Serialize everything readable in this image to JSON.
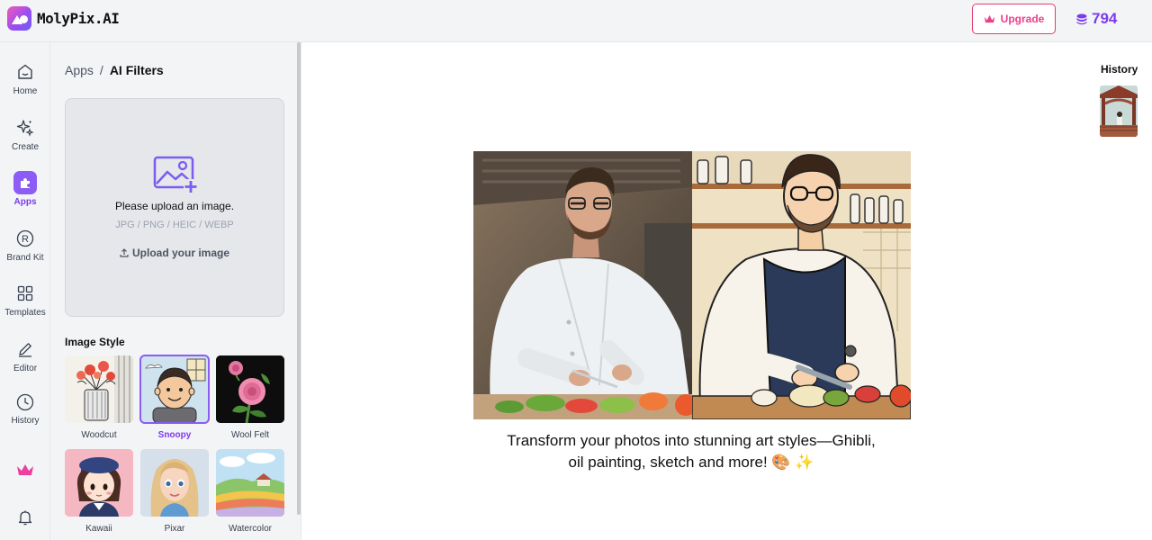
{
  "app": {
    "name": "MolyPix.AI"
  },
  "header": {
    "upgrade_label": "Upgrade",
    "credits": "794"
  },
  "rail": {
    "items": [
      {
        "label": "Home",
        "icon": "home-icon"
      },
      {
        "label": "Create",
        "icon": "sparkle-icon"
      },
      {
        "label": "Apps",
        "icon": "puzzle-icon",
        "active": true
      },
      {
        "label": "Brand Kit",
        "icon": "registered-icon"
      },
      {
        "label": "Templates",
        "icon": "grid-icon"
      },
      {
        "label": "Editor",
        "icon": "pencil-icon"
      },
      {
        "label": "History",
        "icon": "clock-icon"
      }
    ]
  },
  "breadcrumb": {
    "root": "Apps",
    "separator": "/",
    "current": "AI Filters"
  },
  "upload": {
    "title": "Please upload an image.",
    "formats": "JPG / PNG / HEIC / WEBP",
    "action": "Upload your image"
  },
  "image_style": {
    "title": "Image Style",
    "styles": [
      {
        "label": "Woodcut"
      },
      {
        "label": "Snoopy",
        "selected": true
      },
      {
        "label": "Wool Felt"
      },
      {
        "label": "Kawaii"
      },
      {
        "label": "Pixar"
      },
      {
        "label": "Watercolor"
      }
    ]
  },
  "history": {
    "title": "History"
  },
  "main": {
    "tagline": "Transform your photos into stunning art styles—Ghibli, oil painting, sketch and more! 🎨 ✨"
  },
  "colors": {
    "accent": "#8b5cf6",
    "upgrade": "#ea3f8c",
    "credits": "#7c3aed"
  }
}
